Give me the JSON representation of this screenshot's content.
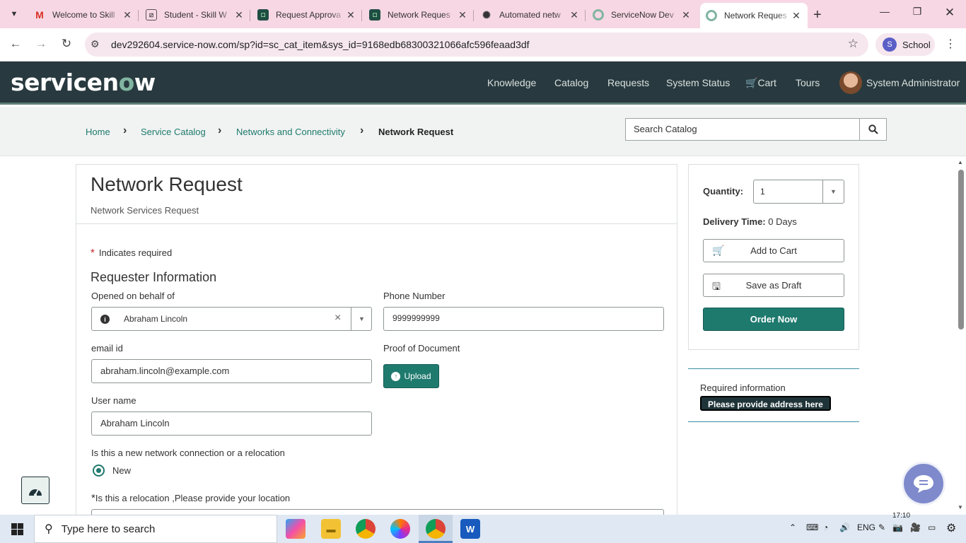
{
  "browser": {
    "tabs": [
      {
        "title": "Welcome to Skill",
        "favicon": "gmail-icon",
        "color": "#d93025"
      },
      {
        "title": "Student - Skill W",
        "favicon": "image-icon",
        "color": "#6e6e6e"
      },
      {
        "title": "Request Approva",
        "favicon": "servicenow-icon",
        "color": "#1f4d44"
      },
      {
        "title": "Network Reques",
        "favicon": "servicenow-icon",
        "color": "#1f4d44"
      },
      {
        "title": "Automated netw",
        "favicon": "chatgpt-icon",
        "color": "#333333"
      },
      {
        "title": "ServiceNow Dev",
        "favicon": "servicenow-dev-icon",
        "color": "#81b5a1"
      },
      {
        "title": "Network Reques",
        "favicon": "servicenow-dev-icon",
        "color": "#81b5a1",
        "active": true
      }
    ],
    "url": "dev292604.service-now.com/sp?id=sc_cat_item&sys_id=9168edb68300321066afc596feaad3df",
    "profile_label": "School",
    "profile_initial": "S"
  },
  "header": {
    "logo_text_pre": "servicen",
    "logo_text_o": "o",
    "logo_text_post": "w",
    "nav": [
      "Knowledge",
      "Catalog",
      "Requests",
      "System Status",
      "Cart",
      "Tours"
    ],
    "user_name": "System Administrator"
  },
  "breadcrumb": {
    "items": [
      "Home",
      "Service Catalog",
      "Networks and Connectivity",
      "Network Request"
    ]
  },
  "search": {
    "placeholder": "Search Catalog"
  },
  "form": {
    "title": "Network Request",
    "subtitle": "Network Services Request",
    "required_note": "Indicates required",
    "section_title": "Requester Information",
    "opened_on_behalf_label": "Opened on behalf of",
    "opened_on_behalf_value": "Abraham Lincoln",
    "phone_label": "Phone Number",
    "phone_value": "9999999999",
    "email_label": "email id",
    "email_value": "abraham.lincoln@example.com",
    "proof_label": "Proof of Document",
    "upload_label": "Upload",
    "username_label": "User name",
    "username_value": "Abraham Lincoln",
    "connection_question": "Is this a new network connection or a relocation",
    "connection_option": "New",
    "relocation_question": "Is this a relocation ,Please provide your location"
  },
  "order_panel": {
    "quantity_label": "Quantity:",
    "quantity_value": "1",
    "delivery_label": "Delivery Time:",
    "delivery_value": "0 Days",
    "add_to_cart": "Add to Cart",
    "save_draft": "Save as Draft",
    "order_now": "Order Now"
  },
  "required_info": {
    "heading": "Required information",
    "item": "Please provide address here"
  },
  "taskbar": {
    "search_placeholder": "Type here to search",
    "language": "ENG",
    "time": "17:10"
  },
  "colors": {
    "brand_dark": "#283a3f",
    "brand_green": "#1f7a6e",
    "link": "#1e7a6b",
    "tabstrip": "#f8d7e4"
  }
}
